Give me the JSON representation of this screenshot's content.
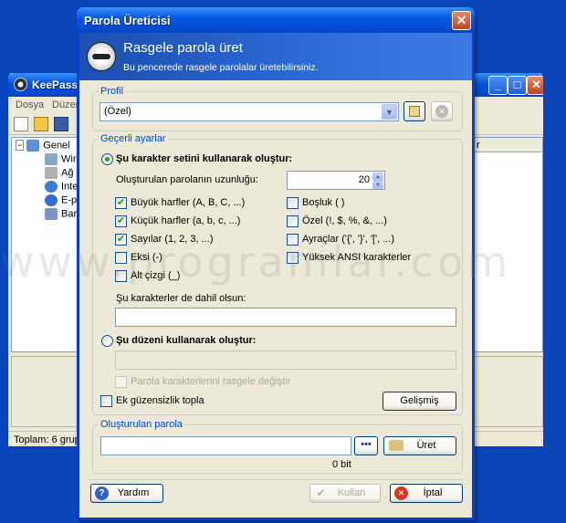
{
  "background_window": {
    "title": "KeePass P",
    "menu": [
      "Dosya",
      "Düzen"
    ],
    "tree": {
      "root": "Genel",
      "children": [
        "Win",
        "Ağ",
        "Inte",
        "E-p",
        "Bar"
      ]
    },
    "list_header": "r",
    "status": "Toplam: 6 grupta"
  },
  "dialog": {
    "title": "Parola Üreticisi",
    "close": "✕",
    "banner": {
      "title": "Rasgele parola üret",
      "subtitle": "Bu pencerede rasgele parolalar üretebilirsiniz."
    },
    "profile": {
      "label": "Profil",
      "value": "(Özel)"
    },
    "settings": {
      "label": "Geçerli ayarlar",
      "option_charset": "Şu karakter setini kullanarak oluştur:",
      "length_label": "Oluşturulan parolanın uzunluğu:",
      "length_value": "20",
      "checkboxes_left": [
        {
          "label": "Büyük harfler (A, B, C, ...)",
          "checked": true
        },
        {
          "label": "Küçük harfler (a, b, c, ...)",
          "checked": true
        },
        {
          "label": "Sayılar (1, 2, 3, ...)",
          "checked": true
        },
        {
          "label": "Eksi (-)",
          "checked": false
        },
        {
          "label": "Alt çizgi (_)",
          "checked": false
        }
      ],
      "checkboxes_right": [
        {
          "label": "Boşluk ( )",
          "checked": false
        },
        {
          "label": "Özel (!, $, %, &, ...)",
          "checked": false
        },
        {
          "label": "Ayraçlar ('{', '}', '[', ...)",
          "checked": false
        },
        {
          "label": "Yüksek ANSI karakterler",
          "checked": false
        }
      ],
      "include_label": "Şu karakterler de dahil olsun:",
      "include_value": "",
      "option_pattern": "Şu düzeni kullanarak oluştur:",
      "pattern_value": "",
      "shuffle_label": "Parola karakterlerini rasgele değiştir",
      "extra_entropy": "Ek güzensizlik topla",
      "advanced_button": "Gelişmiş"
    },
    "generated": {
      "label": "Oluşturulan parola",
      "value": "",
      "dots": "•••",
      "generate_button": "Üret",
      "bits": "0 bit"
    },
    "footer": {
      "help": "Yardım",
      "use": "Kullan",
      "cancel": "İptal"
    }
  },
  "watermark": "www.programlar.com",
  "colors": {
    "desktop": "#0a46ba",
    "titlebar": "#0a58e4",
    "group_label": "#0046d5",
    "check": "#21a121"
  }
}
